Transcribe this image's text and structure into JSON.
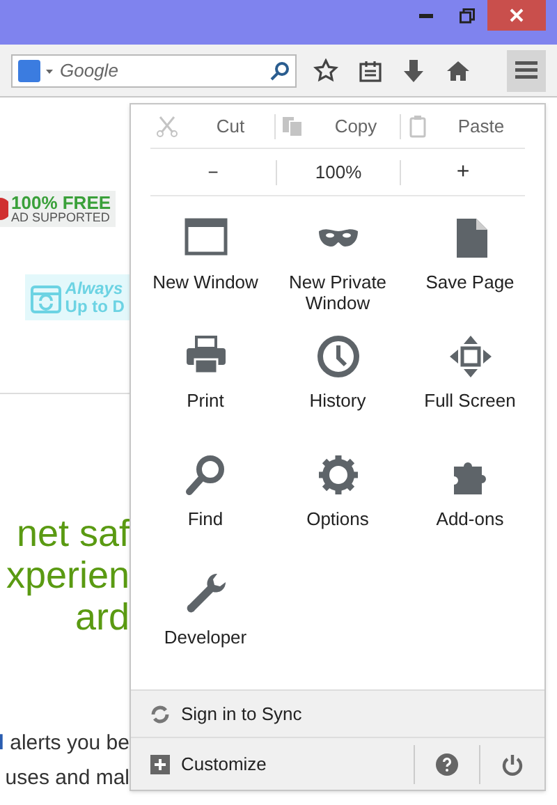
{
  "toolbar": {
    "search": {
      "placeholder": "Google"
    }
  },
  "page": {
    "badge": {
      "title": "100% FREE",
      "subtitle": "AD SUPPORTED"
    },
    "update_badge": {
      "line_1": "Always",
      "line_2": "Up to D"
    },
    "headline": [
      "net saf",
      "xperien",
      "ard"
    ],
    "paragraph": [
      {
        "link": "l",
        "text": "alerts you be"
      },
      {
        "text": "uses and mal"
      }
    ]
  },
  "menu": {
    "edit": [
      {
        "kind": "cut",
        "label": "Cut",
        "disabled": true
      },
      {
        "kind": "copy",
        "label": "Copy",
        "disabled": true
      },
      {
        "kind": "paste",
        "label": "Paste",
        "disabled": true
      }
    ],
    "zoom": {
      "out": "−",
      "level": "100%",
      "in": "+"
    },
    "items": [
      {
        "kind": "window",
        "label": "New Window"
      },
      {
        "kind": "mask",
        "label": "New Private Window"
      },
      {
        "kind": "page",
        "label": "Save Page"
      },
      {
        "kind": "printer",
        "label": "Print"
      },
      {
        "kind": "clock",
        "label": "History"
      },
      {
        "kind": "fullscreen",
        "label": "Full Screen"
      },
      {
        "kind": "search",
        "label": "Find"
      },
      {
        "kind": "gear",
        "label": "Options"
      },
      {
        "kind": "puzzle",
        "label": "Add-ons"
      },
      {
        "kind": "wrench",
        "label": "Developer"
      }
    ],
    "sync": "Sign in to Sync",
    "customize": "Customize"
  }
}
